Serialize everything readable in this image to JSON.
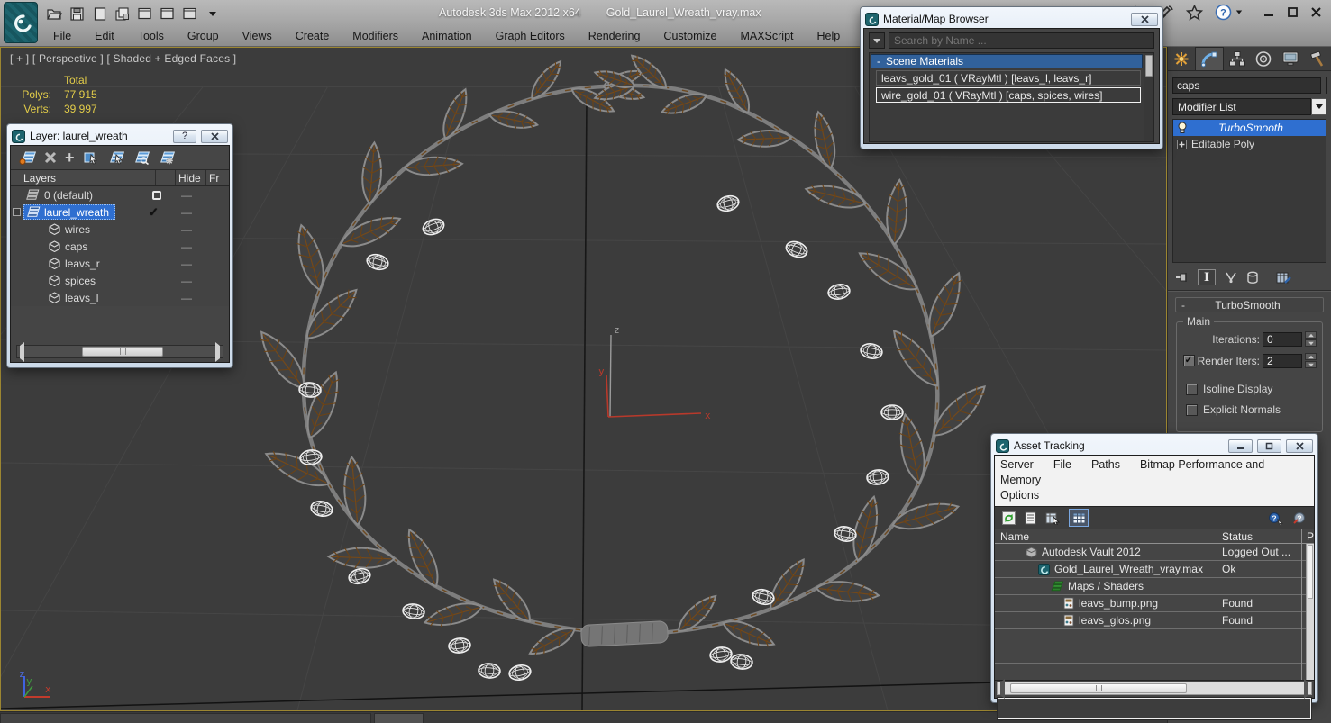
{
  "titlebar": {
    "app_title": "Autodesk 3ds Max 2012 x64",
    "file_title": "Gold_Laurel_Wreath_vray.max"
  },
  "menubar": {
    "items": [
      "File",
      "Edit",
      "Tools",
      "Group",
      "Views",
      "Create",
      "Modifiers",
      "Animation",
      "Graph Editors",
      "Rendering",
      "Customize",
      "MAXScript",
      "Help"
    ]
  },
  "viewport": {
    "label": "[ + ] [ Perspective ] [ Shaded + Edged Faces ]",
    "stats": {
      "total": "Total",
      "polys_label": "Polys:",
      "polys_value": "77 915",
      "verts_label": "Verts:",
      "verts_value": "39 997"
    },
    "axis_center": {
      "x": "x",
      "y": "y",
      "z": "z"
    },
    "axis_corner": {
      "x": "x",
      "y": "y",
      "z": "z"
    }
  },
  "layer_dialog": {
    "title": "Layer: laurel_wreath",
    "columns": {
      "layers": "Layers",
      "hide": "Hide",
      "freeze": "Fr"
    },
    "rows": [
      {
        "label": "0 (default)"
      },
      {
        "label": "laurel_wreath",
        "check": "✓"
      },
      {
        "label": "wires"
      },
      {
        "label": "caps"
      },
      {
        "label": "leavs_r"
      },
      {
        "label": "spices"
      },
      {
        "label": "leavs_l"
      }
    ]
  },
  "material_browser": {
    "title": "Material/Map Browser",
    "search_placeholder": "Search by Name ...",
    "section": "Scene Materials",
    "items": [
      {
        "label": "leavs_gold_01 ( VRayMtl ) [leavs_l, leavs_r]"
      },
      {
        "label": "wire_gold_01 ( VRayMtl ) [caps, spices, wires]"
      }
    ]
  },
  "command_panel": {
    "object_name": "caps",
    "modifier_list": "Modifier List",
    "stack": [
      {
        "label": "TurboSmooth"
      },
      {
        "label": "Editable Poly"
      }
    ],
    "rollout_title": "TurboSmooth",
    "group_title": "Main",
    "iterations_label": "Iterations:",
    "iterations_value": "0",
    "render_iters_label": "Render Iters:",
    "render_iters_value": "2",
    "checkbox1": "Isoline Display",
    "checkbox2": "Explicit Normals"
  },
  "asset_tracking": {
    "title": "Asset Tracking",
    "menus": [
      "Server",
      "File",
      "Paths",
      "Bitmap Performance and Memory",
      "Options"
    ],
    "columns": {
      "name": "Name",
      "status": "Status",
      "p": "P"
    },
    "rows": [
      {
        "name": "Autodesk Vault 2012",
        "status": "Logged Out ..."
      },
      {
        "name": "Gold_Laurel_Wreath_vray.max",
        "status": "Ok"
      },
      {
        "name": "Maps / Shaders",
        "status": ""
      },
      {
        "name": "leavs_bump.png",
        "status": "Found"
      },
      {
        "name": "leavs_glos.png",
        "status": "Found"
      }
    ]
  },
  "glyphs": {
    "minus": "-",
    "plus": "+",
    "help": "?",
    "check": "✓",
    "dash": "—",
    "show_end": "I"
  }
}
